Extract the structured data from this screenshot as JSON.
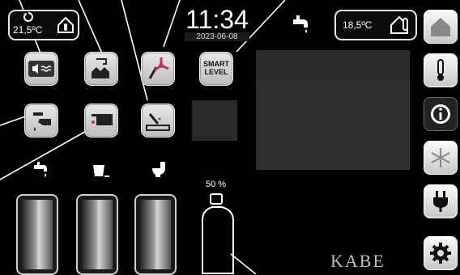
{
  "status": {
    "outside_temp": "21,5ºC",
    "clock": "11:34",
    "date": "2023-06-08",
    "inside_temp": "18,5ºC"
  },
  "gas": {
    "level_percent": 50,
    "label": "50 %"
  },
  "brand": "KABE",
  "sidebar": {
    "items": [
      {
        "icon": "home-icon",
        "active": false
      },
      {
        "icon": "thermometer-icon",
        "active": false
      },
      {
        "icon": "info-icon",
        "active": true
      },
      {
        "icon": "snowflake-icon",
        "active": false
      },
      {
        "icon": "plug-icon",
        "active": false
      },
      {
        "icon": "gear-icon",
        "active": false
      }
    ]
  },
  "buttons": {
    "smart_level": "SMART\nLEVEL"
  },
  "tanks": [
    {
      "name": "fresh-water",
      "icon": "tap-icon"
    },
    {
      "name": "grey-water",
      "icon": "bucket-icon"
    },
    {
      "name": "black-water",
      "icon": "toilet-icon"
    }
  ]
}
